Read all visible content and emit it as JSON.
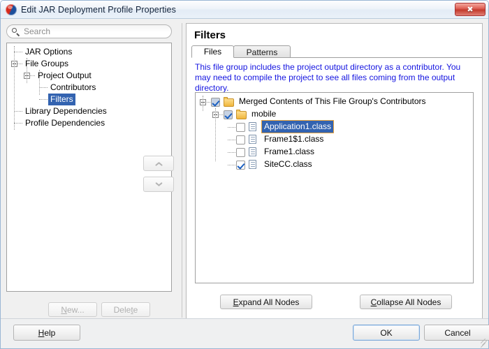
{
  "window": {
    "title": "Edit JAR Deployment Profile Properties",
    "app_icon": "jdeveloper-icon",
    "close_label": "✖"
  },
  "search": {
    "placeholder": "Search",
    "value": "",
    "icon": "search-icon"
  },
  "nav_tree": {
    "items": [
      {
        "label": "JAR Options",
        "level": 1,
        "expander": "none",
        "selected": false
      },
      {
        "label": "File Groups",
        "level": 1,
        "expander": "expanded",
        "selected": false
      },
      {
        "label": "Project Output",
        "level": 2,
        "expander": "expanded",
        "selected": false
      },
      {
        "label": "Contributors",
        "level": 3,
        "expander": "none",
        "selected": false
      },
      {
        "label": "Filters",
        "level": 3,
        "expander": "none",
        "selected": true
      },
      {
        "label": "Library Dependencies",
        "level": 1,
        "expander": "none",
        "selected": false
      },
      {
        "label": "Profile Dependencies",
        "level": 1,
        "expander": "none",
        "selected": false
      }
    ]
  },
  "reorder_buttons": {
    "move_up": "move-up-chevron",
    "move_down": "move-down-chevron"
  },
  "left_buttons": {
    "new": {
      "prefix": "",
      "accel": "N",
      "suffix": "ew...",
      "enabled": false
    },
    "delete": {
      "prefix": "Dele",
      "accel": "t",
      "suffix": "e",
      "enabled": false
    }
  },
  "panel": {
    "title": "Filters",
    "tabs": [
      {
        "label": "Files",
        "active": true
      },
      {
        "label": "Patterns",
        "active": false
      }
    ],
    "description": "This file group includes the project output directory as a contributor.  You may need to compile the project to see all files coming from the output directory.",
    "description_color": "#1414e0"
  },
  "file_tree": {
    "nodes": [
      {
        "label": "Merged Contents of This File Group's Contributors",
        "level": 0,
        "expander": "expanded",
        "checkbox": "shaded",
        "icon": "folder-icon",
        "selected": false
      },
      {
        "label": "mobile",
        "level": 1,
        "expander": "expanded",
        "checkbox": "shaded",
        "icon": "folder-icon",
        "selected": false
      },
      {
        "label": "Application1.class",
        "level": 2,
        "expander": "none",
        "checkbox": "unchecked",
        "icon": "file-icon",
        "selected": true
      },
      {
        "label": "Frame1$1.class",
        "level": 2,
        "expander": "none",
        "checkbox": "unchecked",
        "icon": "file-icon",
        "selected": false
      },
      {
        "label": "Frame1.class",
        "level": 2,
        "expander": "none",
        "checkbox": "unchecked",
        "icon": "file-icon",
        "selected": false
      },
      {
        "label": "SiteCC.class",
        "level": 2,
        "expander": "none",
        "checkbox": "checked",
        "icon": "file-icon",
        "selected": false
      }
    ],
    "selection_accent": "#e8a33d",
    "selection_fill": "#3363b0"
  },
  "tree_buttons": {
    "expand_all": {
      "accel": "E",
      "rest": "xpand All Nodes"
    },
    "collapse_all": {
      "accel": "C",
      "rest": "ollapse All Nodes"
    }
  },
  "footer": {
    "help": {
      "prefix": "",
      "accel": "H",
      "suffix": "elp"
    },
    "ok": {
      "label": "OK",
      "default": true
    },
    "cancel": {
      "label": "Cancel"
    }
  }
}
